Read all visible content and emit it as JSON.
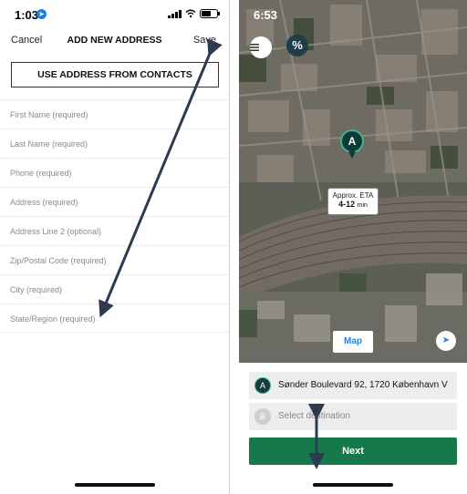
{
  "left": {
    "status": {
      "time": "1:03"
    },
    "nav": {
      "cancel": "Cancel",
      "title": "ADD NEW ADDRESS",
      "save": "Save"
    },
    "contacts_button": "USE ADDRESS FROM CONTACTS",
    "fields": [
      "First Name (required)",
      "Last Name (required)",
      "Phone (required)",
      "Address (required)",
      "Address Line 2 (optional)",
      "Zip/Postal Code (required)",
      "City (required)",
      "State/Region (required)"
    ]
  },
  "right": {
    "status": {
      "time": "6:53"
    },
    "percent_button": "%",
    "pin_label": "A",
    "eta": {
      "label": "Approx. ETA",
      "range": "4-12",
      "unit": "min"
    },
    "map_button": "Map",
    "origin": {
      "badge": "A",
      "address": "Sønder Boulevard 92, 1720 København V"
    },
    "destination": {
      "badge": "B",
      "placeholder": "Select destination"
    },
    "next_button": "Next"
  },
  "icons": [
    "location-arrow-icon",
    "signal-icon",
    "wifi-icon",
    "battery-icon",
    "menu-icon",
    "navigate-icon"
  ],
  "colors": {
    "next_green": "#16794a",
    "pin_dark": "#0f3a3a",
    "accent_blue": "#2a82d8",
    "arrow": "#2e3a4f"
  }
}
